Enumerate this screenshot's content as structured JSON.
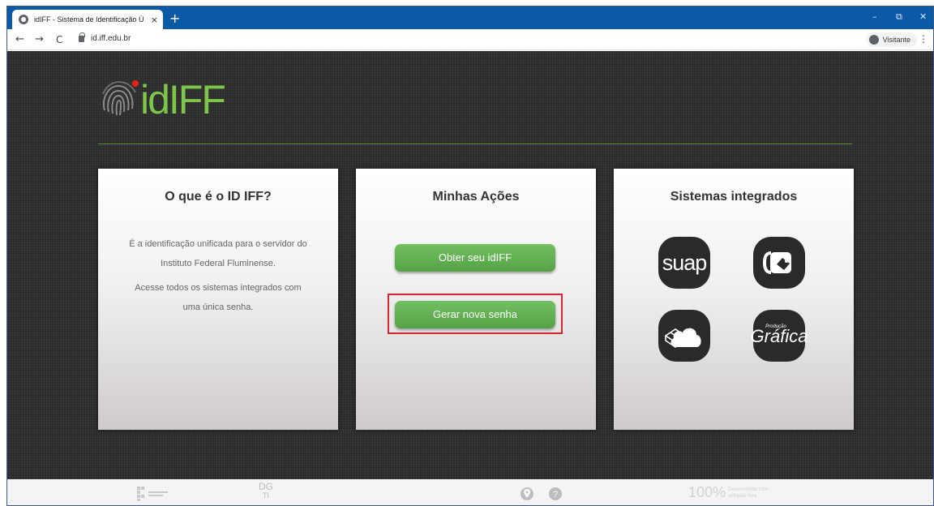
{
  "browser": {
    "tab_title": "idIFF - Sistema de Identificação Ú",
    "tab_close": "×",
    "new_tab": "+",
    "url": "id.iff.edu.br",
    "profile_label": "Visitante",
    "controls": {
      "minimize": "–",
      "restore": "⧉",
      "close": "✕"
    },
    "nav": {
      "back": "←",
      "forward": "→",
      "reload": "C",
      "menu": "⋮"
    }
  },
  "header": {
    "logo_text": "idIFF"
  },
  "cards": {
    "about": {
      "title": "O que é o ID IFF?",
      "paragraph1_line1": "É a identificação unificada para o servidor do",
      "paragraph1_line2": "Instituto Federal Fluminense.",
      "paragraph2_line1": "Acesse todos os sistemas integrados com",
      "paragraph2_line2": "uma única senha."
    },
    "actions": {
      "title": "Minhas Ações",
      "obtain_button": "Obter seu idIFF",
      "new_password_button": "Gerar nova senha"
    },
    "systems": {
      "title": "Sistemas integrados",
      "suap_label": "suap",
      "grafica_label": "Gráfica",
      "grafica_small": "Produção"
    }
  },
  "footer": {
    "percent": "100%",
    "free_line1": "Desenvolvido com",
    "free_line2": "software livre",
    "dgti": "DG",
    "dgti_sub": "TI"
  },
  "colors": {
    "accent_green": "#5cab4c",
    "logo_green": "#7ec64b",
    "chrome_blue": "#0c5aa6",
    "highlight_red": "#d7262f"
  }
}
